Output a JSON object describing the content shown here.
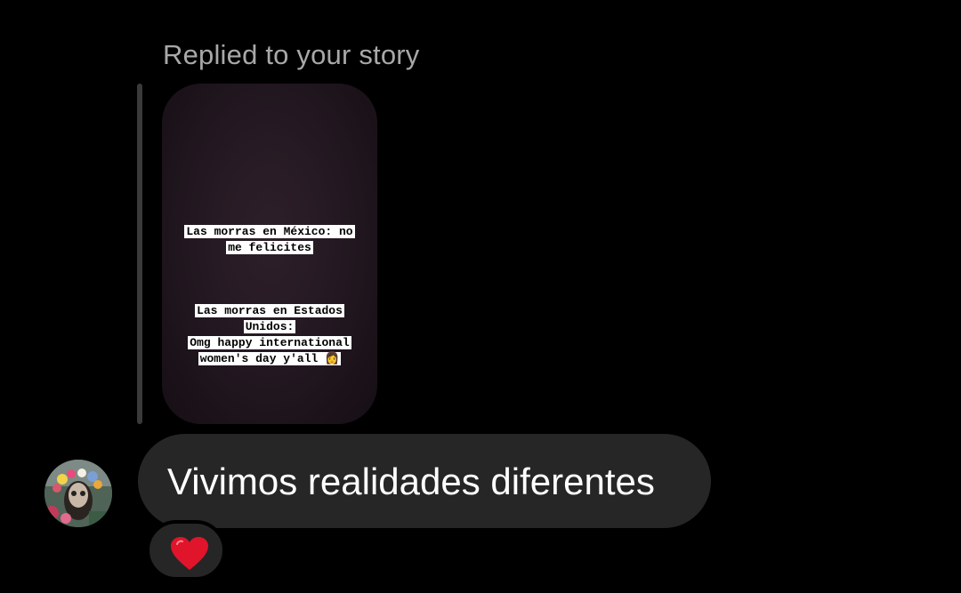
{
  "reply": {
    "label": "Replied to your story"
  },
  "story": {
    "block1": {
      "line1": "Las morras en México: no",
      "line2": "me felicites"
    },
    "block2": {
      "line1": "Las morras en Estados",
      "line2": "Unidos:",
      "line3": "Omg happy international",
      "line4": "women's day y'all 👩"
    }
  },
  "message": {
    "text": "Vivimos realidades diferentes"
  },
  "reaction": {
    "emoji_icon": "red-heart-icon",
    "color": "#e0142b"
  },
  "colors": {
    "background": "#000000",
    "bubble": "#262626",
    "secondary_text": "#a8a8a8"
  }
}
